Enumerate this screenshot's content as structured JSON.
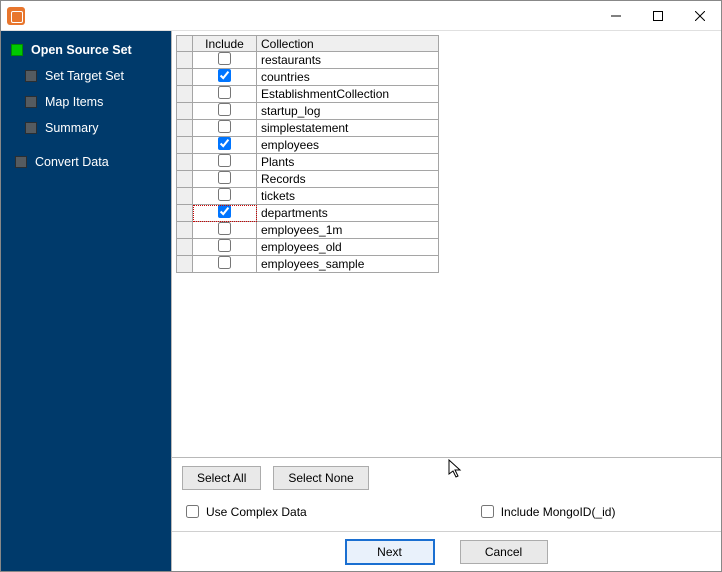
{
  "nav": {
    "open_source_set": "Open Source Set",
    "set_target_set": "Set Target Set",
    "map_items": "Map Items",
    "summary": "Summary",
    "convert_data": "Convert Data"
  },
  "table": {
    "headers": {
      "include": "Include",
      "collection": "Collection"
    },
    "rows": [
      {
        "checked": false,
        "name": "restaurants"
      },
      {
        "checked": true,
        "name": "countries"
      },
      {
        "checked": false,
        "name": "EstablishmentCollection"
      },
      {
        "checked": false,
        "name": "startup_log"
      },
      {
        "checked": false,
        "name": "simplestatement"
      },
      {
        "checked": true,
        "name": "employees"
      },
      {
        "checked": false,
        "name": "Plants"
      },
      {
        "checked": false,
        "name": "Records"
      },
      {
        "checked": false,
        "name": "tickets"
      },
      {
        "checked": true,
        "name": "departments",
        "focused": true
      },
      {
        "checked": false,
        "name": "employees_1m"
      },
      {
        "checked": false,
        "name": "employees_old"
      },
      {
        "checked": false,
        "name": "employees_sample"
      }
    ]
  },
  "buttons": {
    "select_all": "Select All",
    "select_none": "Select None",
    "next": "Next",
    "cancel": "Cancel"
  },
  "checks": {
    "use_complex_data": "Use Complex Data",
    "include_mongoid": "Include MongoID(_id)"
  }
}
